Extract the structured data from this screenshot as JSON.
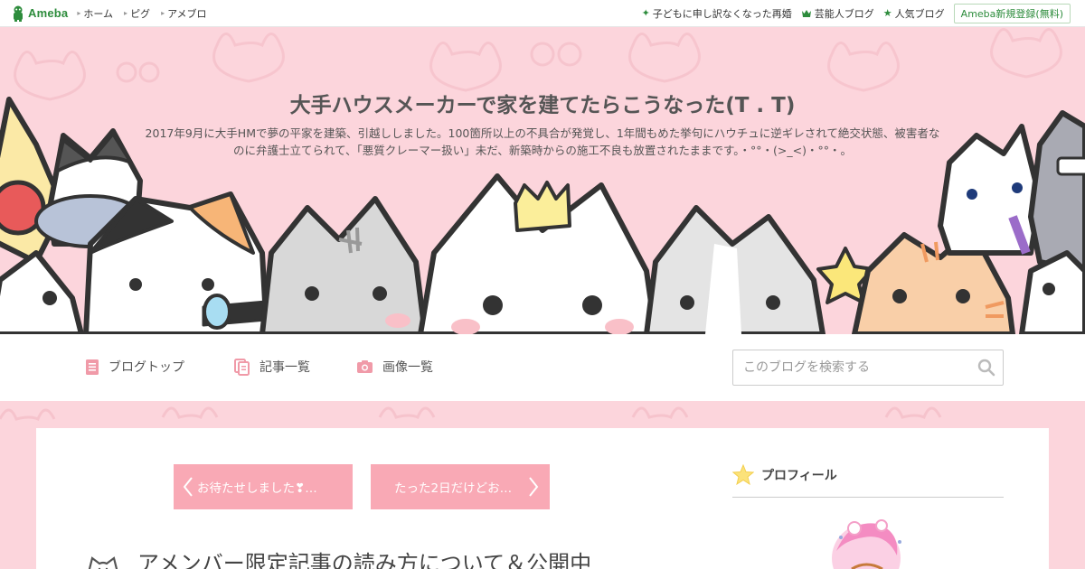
{
  "topbar": {
    "logo_text": "Ameba",
    "nav": [
      "ホーム",
      "ピグ",
      "アメブロ"
    ],
    "right_links": [
      {
        "icon": "sparkle-icon",
        "label": "子どもに申し訳なくなった再婚"
      },
      {
        "icon": "crown-icon",
        "label": "芸能人ブログ"
      },
      {
        "icon": "star-icon",
        "label": "人気ブログ"
      }
    ],
    "signup_label": "Ameba新規登録(無料)"
  },
  "header": {
    "title": "大手ハウスメーカーで家を建てたらこうなった(T . T)",
    "description": "2017年9月に大手HMで夢の平家を建築、引越ししました。100箇所以上の不具合が発覚し、1年間もめた挙句にハウチュに逆ギレされて絶交状態、被害者なのに弁護士立てられて、「悪質クレーマー扱い」未だ、新築時からの施工不良も放置されたままです。・°°・(>_<)・°°・。"
  },
  "blognav": {
    "items": [
      {
        "icon": "blog-top-icon",
        "label": "ブログトップ"
      },
      {
        "icon": "article-list-icon",
        "label": "記事一覧"
      },
      {
        "icon": "camera-icon",
        "label": "画像一覧"
      }
    ],
    "search_placeholder": "このブログを検索する"
  },
  "pager": {
    "prev_label": "お待たせしました❣…",
    "next_label": "たった2日だけどお…"
  },
  "article": {
    "title": "アメンバー限定記事の読み方について＆公開中"
  },
  "sidebar": {
    "profile_heading": "プロフィール"
  },
  "colors": {
    "brand_green": "#2d8c3c",
    "header_pink": "#fcd5dc",
    "pager_pink": "#f9a9b5",
    "icon_pink": "#f09aa8"
  }
}
